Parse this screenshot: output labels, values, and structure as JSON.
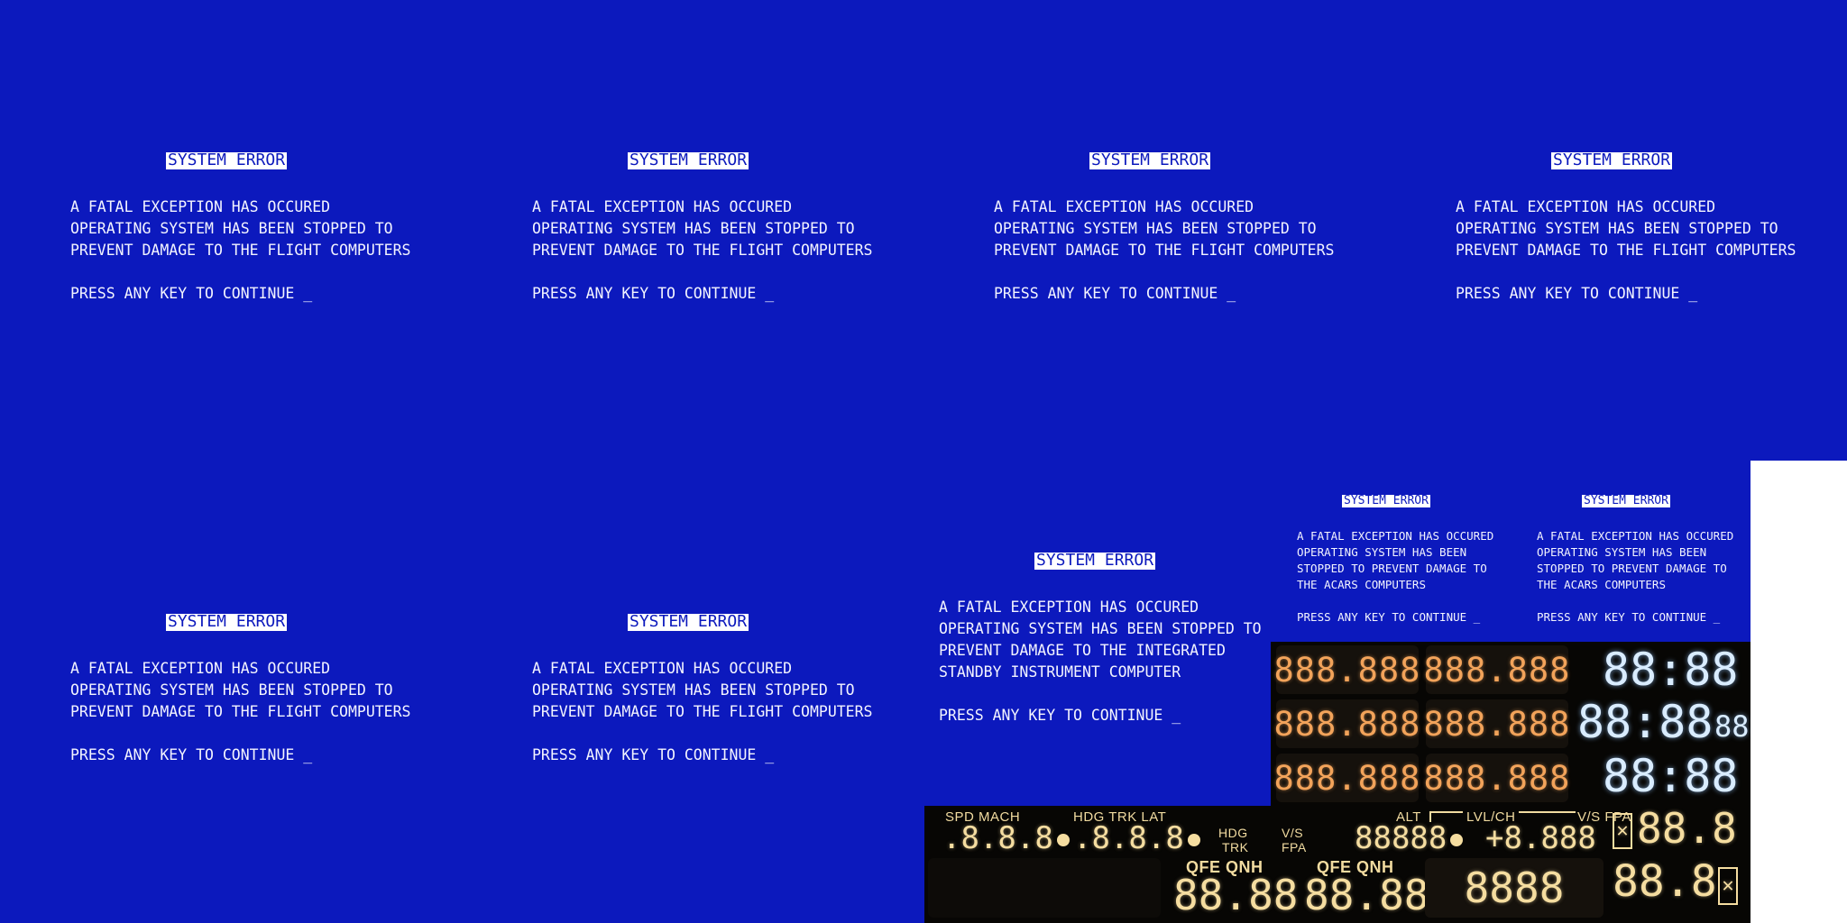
{
  "screens_large": [
    {
      "title": "SYSTEM ERROR",
      "lines": [
        "A FATAL EXCEPTION HAS OCCURED",
        "OPERATING SYSTEM HAS BEEN STOPPED TO",
        "PREVENT DAMAGE TO THE FLIGHT COMPUTERS",
        "",
        "PRESS ANY KEY TO CONTINUE _"
      ]
    },
    {
      "title": "SYSTEM ERROR",
      "lines": [
        "A FATAL EXCEPTION HAS OCCURED",
        "OPERATING SYSTEM HAS BEEN STOPPED TO",
        "PREVENT DAMAGE TO THE FLIGHT COMPUTERS",
        "",
        "PRESS ANY KEY TO CONTINUE _"
      ]
    },
    {
      "title": "SYSTEM ERROR",
      "lines": [
        "A FATAL EXCEPTION HAS OCCURED",
        "OPERATING SYSTEM HAS BEEN STOPPED TO",
        "PREVENT DAMAGE TO THE FLIGHT COMPUTERS",
        "",
        "PRESS ANY KEY TO CONTINUE _"
      ]
    },
    {
      "title": "SYSTEM ERROR",
      "lines": [
        "A FATAL EXCEPTION HAS OCCURED",
        "OPERATING SYSTEM HAS BEEN STOPPED TO",
        "PREVENT DAMAGE TO THE FLIGHT COMPUTERS",
        "",
        "PRESS ANY KEY TO CONTINUE _"
      ]
    },
    {
      "title": "SYSTEM ERROR",
      "lines": [
        "A FATAL EXCEPTION HAS OCCURED",
        "OPERATING SYSTEM HAS BEEN STOPPED TO",
        "PREVENT DAMAGE TO THE FLIGHT COMPUTERS",
        "",
        "PRESS ANY KEY TO CONTINUE _"
      ]
    },
    {
      "title": "SYSTEM ERROR",
      "lines": [
        "A FATAL EXCEPTION HAS OCCURED",
        "OPERATING SYSTEM HAS BEEN STOPPED TO",
        "PREVENT DAMAGE TO THE FLIGHT COMPUTERS",
        "",
        "PRESS ANY KEY TO CONTINUE _"
      ]
    },
    {
      "title": "SYSTEM ERROR",
      "lines": [
        "A FATAL EXCEPTION HAS OCCURED",
        "OPERATING SYSTEM HAS BEEN STOPPED TO",
        "PREVENT DAMAGE TO THE INTEGRATED",
        "STANDBY INSTRUMENT COMPUTER",
        "",
        "PRESS ANY KEY TO CONTINUE _"
      ]
    }
  ],
  "screens_small": [
    {
      "title": "SYSTEM ERROR",
      "lines": [
        "A FATAL EXCEPTION HAS OCCURED",
        "OPERATING SYSTEM HAS BEEN",
        "STOPPED TO PREVENT DAMAGE TO",
        "THE ACARS COMPUTERS",
        "",
        "PRESS ANY KEY TO CONTINUE _"
      ]
    },
    {
      "title": "SYSTEM ERROR",
      "lines": [
        "A FATAL EXCEPTION HAS OCCURED",
        "OPERATING SYSTEM HAS BEEN",
        "STOPPED TO PREVENT DAMAGE TO",
        "THE ACARS COMPUTERS",
        "",
        "PRESS ANY KEY TO CONTINUE _"
      ]
    }
  ],
  "colors": {
    "background": "#0c19bd",
    "text": "#f3f4ff",
    "orange_segments": "#f2a35a",
    "blue_segments": "#d9ecff",
    "amber_segments": "#f5dda0"
  },
  "rmp_panel": {
    "displays": [
      "888.888",
      "888.888",
      "888.888",
      "888.888",
      "888.888",
      "888.888"
    ],
    "clock_top": "88:88",
    "clock_mid_main": "88:88",
    "clock_mid_sec": "88",
    "clock_bottom": "88:88"
  },
  "fcu_panel": {
    "spd_label": "SPD MACH",
    "spd_value": ".8.8.8",
    "hdg_label": "HDG TRK LAT",
    "hdg_value": ".8.8.8",
    "hdg_trk_1": "HDG",
    "hdg_trk_2": "TRK",
    "vs_fpa_1": "V/S",
    "vs_fpa_2": "FPA",
    "alt_label": "ALT",
    "lvl_label": "LVL/CH",
    "vs_label": "V/S FPA",
    "alt_value": "88888",
    "vs_value": "+8.888",
    "right_top_value": "88.8",
    "right_top_icon": "segment-x-icon"
  },
  "efis_panel": {
    "qfe_qnh_1": "QFE QNH",
    "baro_1": "88.88",
    "qfe_qnh_2": "QFE QNH",
    "baro_2": "88.88",
    "mid_value": "8888",
    "right_bottom_value": "88.8",
    "right_bottom_icon": "segment-x-icon"
  }
}
